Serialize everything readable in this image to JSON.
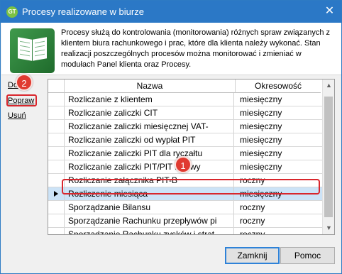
{
  "window": {
    "title": "Procesy realizowane w biurze",
    "icon_text": "GT",
    "close": "✕"
  },
  "info": {
    "icon": "book-icon",
    "description": "Procesy służą do kontrolowania (monitorowania) różnych spraw związanych z klientem biura rachunkowego i prac, które dla klienta należy wykonać. Stan realizacji poszczególnych procesów można monitorować i zmieniać w modułach Panel klienta oraz Procesy."
  },
  "side_links": {
    "add": "Dodaj",
    "edit": "Popraw",
    "delete": "Usuń"
  },
  "annotations": {
    "badge1": "1",
    "badge2": "2",
    "accent": "#e03a30"
  },
  "table": {
    "columns": [
      "Nazwa",
      "Okresowość"
    ],
    "rows": [
      {
        "name": "Rozliczanie z klientem",
        "period": "miesięczny"
      },
      {
        "name": "Rozliczanie zaliczki CIT",
        "period": "miesięczny"
      },
      {
        "name": "Rozliczanie zaliczki miesięcznej VAT-",
        "period": "miesięczny"
      },
      {
        "name": "Rozliczanie zaliczki od wypłat PIT",
        "period": "miesięczny"
      },
      {
        "name": "Rozliczanie zaliczki PIT dla ryczałtu",
        "period": "miesięczny"
      },
      {
        "name": "Rozliczanie zaliczki PIT/PIT liniowy",
        "period": "miesięczny"
      },
      {
        "name": "Rozliczanie załącznika PIT-B",
        "period": "roczny"
      },
      {
        "name": "Rozliczenie miesiąca",
        "period": "miesięczny",
        "selected": true
      },
      {
        "name": "Sporządzanie Bilansu",
        "period": "roczny"
      },
      {
        "name": "Sporządzanie Rachunku przepływów pi",
        "period": "roczny"
      },
      {
        "name": "Sporządzanie Rachunku zysków i strat",
        "period": "roczny"
      }
    ]
  },
  "buttons": {
    "close": "Zamknij",
    "help": "Pomoc"
  }
}
